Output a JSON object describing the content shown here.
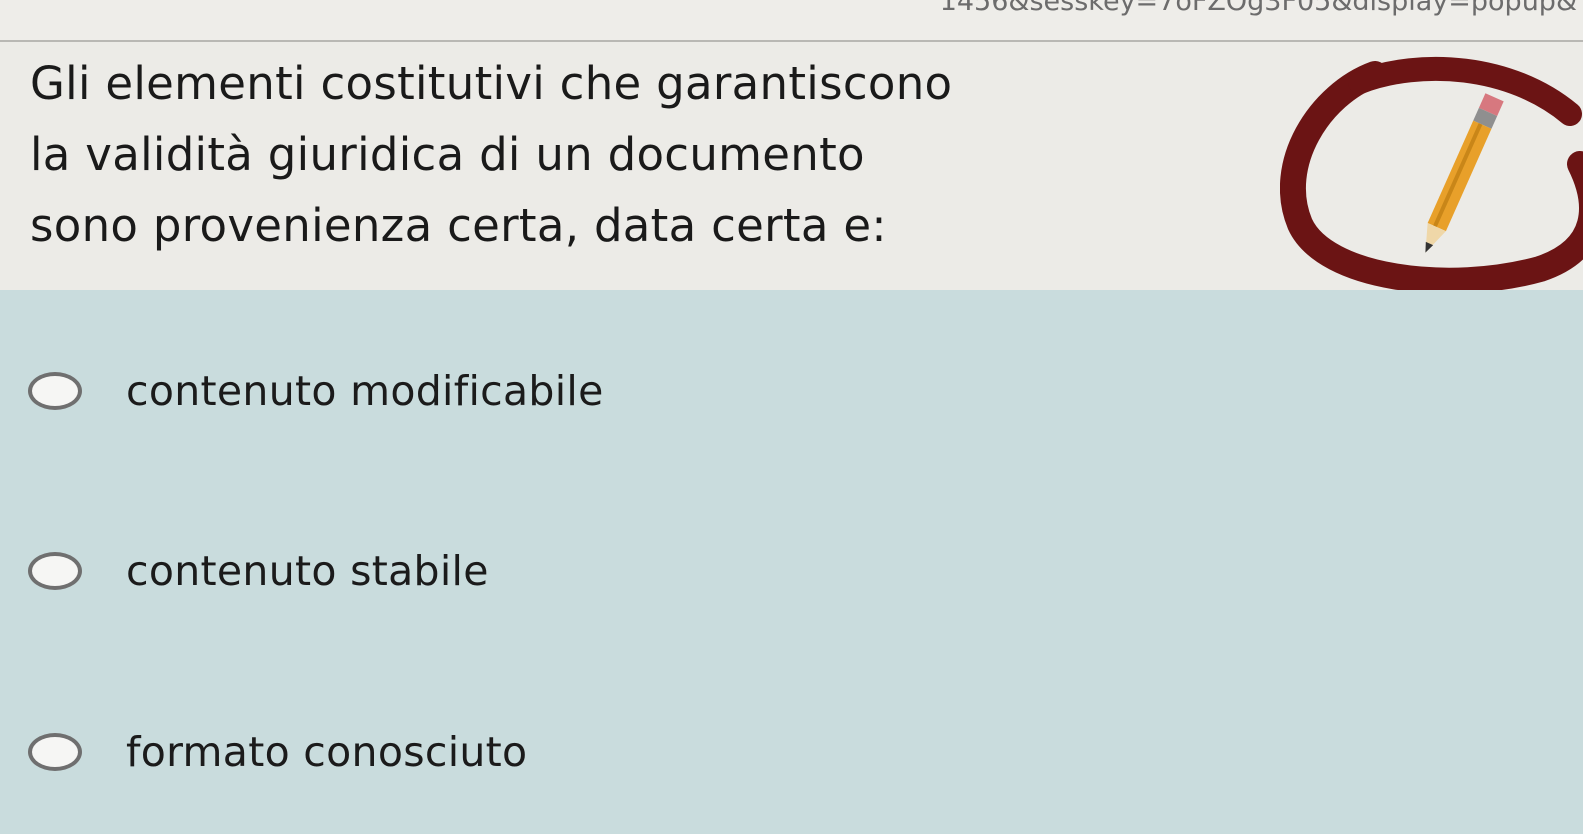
{
  "browser": {
    "url_fragment": "1456&sesskey=7oFZOg3F05&display=popup&"
  },
  "question": {
    "lines": [
      "Gli elementi costitutivi che garantiscono",
      "la validità giuridica di un documento",
      "sono provenienza certa, data certa e:"
    ]
  },
  "badge": {
    "icon": "pencil-icon",
    "ring_color": "#6b1414",
    "pencil_color": "#e8a02a"
  },
  "answers": [
    {
      "label": "contenuto modificabile",
      "selected": false
    },
    {
      "label": "contenuto stabile",
      "selected": false
    },
    {
      "label": "formato conosciuto",
      "selected": false
    }
  ],
  "colors": {
    "answers_bg": "#c9dcdd",
    "question_bg": "#ecebe7"
  }
}
